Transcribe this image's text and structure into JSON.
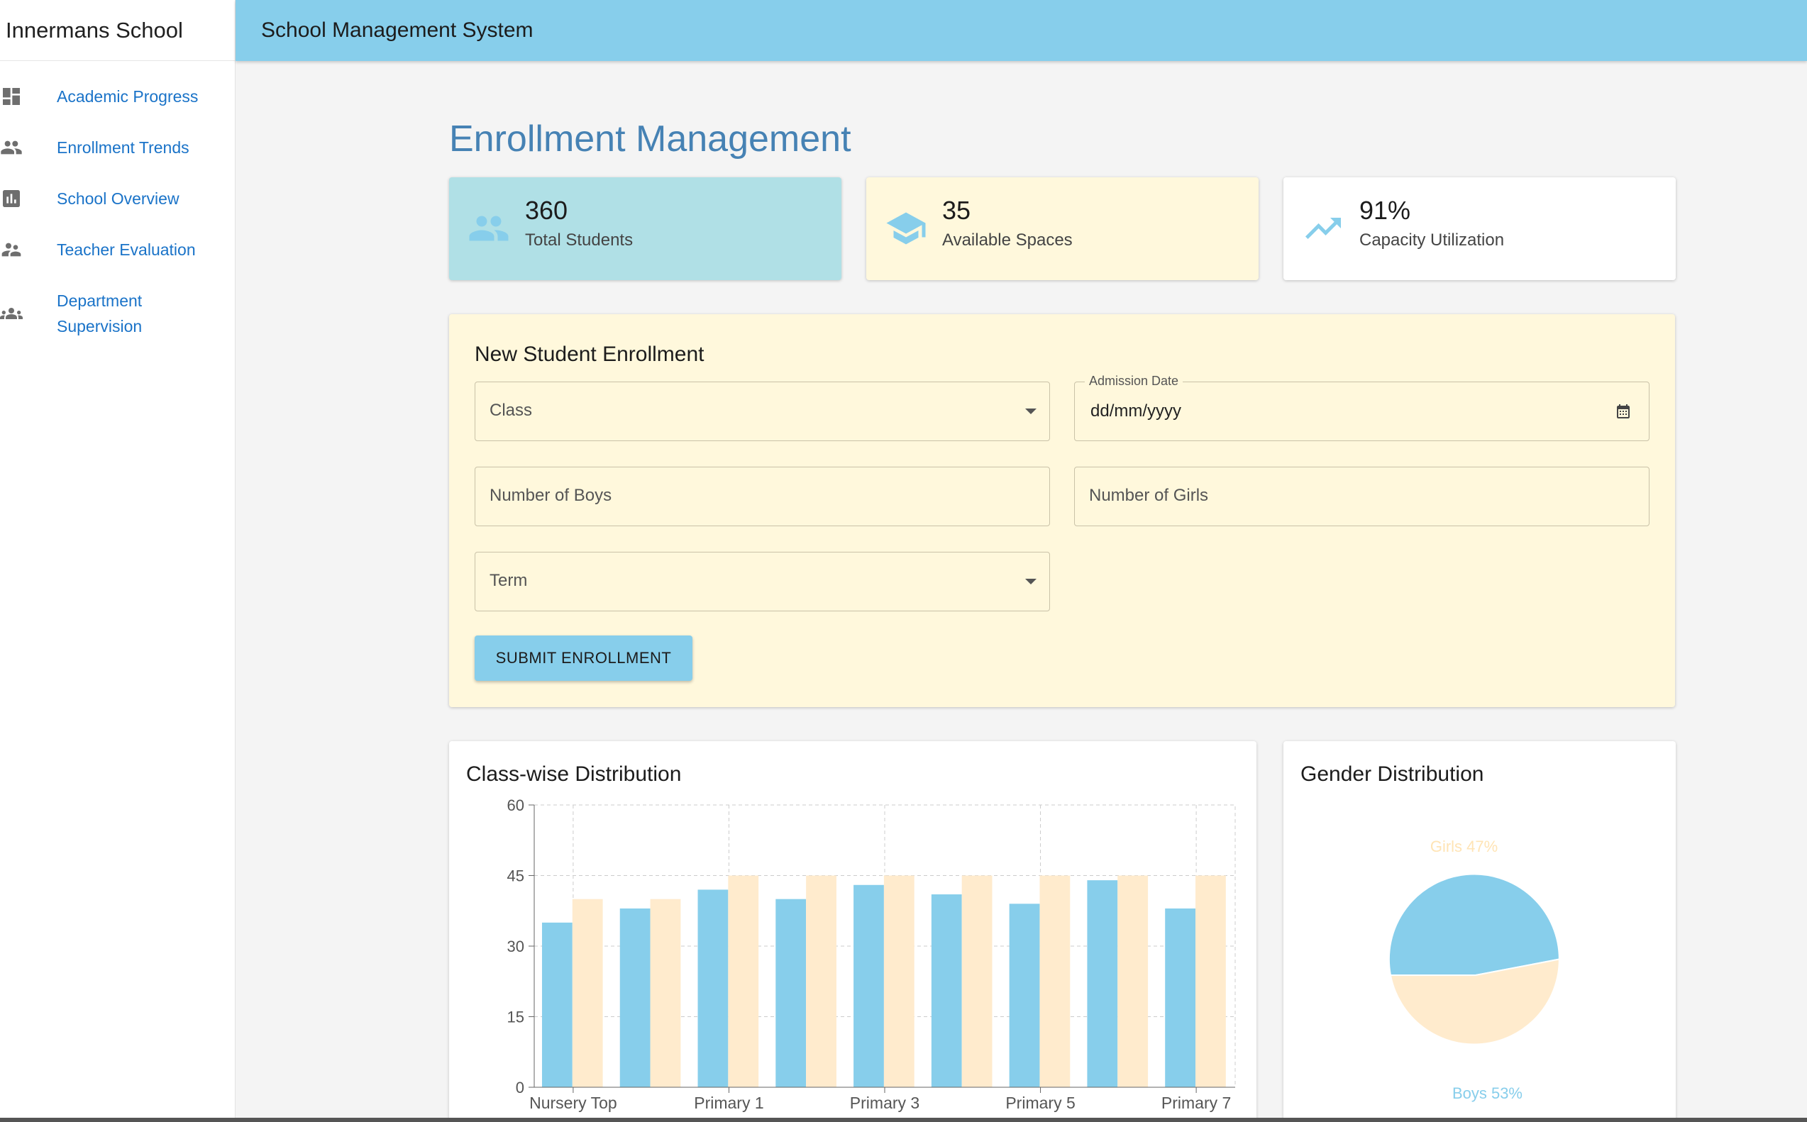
{
  "app": {
    "brand": "Innermans School",
    "title": "School Management System"
  },
  "sidebar": {
    "items": [
      {
        "label": "Academic Progress",
        "icon": "dashboard-icon"
      },
      {
        "label": "Enrollment Trends",
        "icon": "people-icon"
      },
      {
        "label": "School Overview",
        "icon": "bar-chart-icon"
      },
      {
        "label": "Teacher Evaluation",
        "icon": "supervisor-icon"
      },
      {
        "label": "Department Supervision",
        "icon": "groups-icon"
      }
    ]
  },
  "page": {
    "title": "Enrollment Management"
  },
  "stats": [
    {
      "value": "360",
      "label": "Total Students",
      "icon": "people-icon",
      "bg": "#b0e0e6"
    },
    {
      "value": "35",
      "label": "Available Spaces",
      "icon": "graduation-cap-icon",
      "bg": "#fff8dc"
    },
    {
      "value": "91%",
      "label": "Capacity Utilization",
      "icon": "trending-up-icon",
      "bg": "#ffffff"
    }
  ],
  "form": {
    "title": "New Student Enrollment",
    "class_placeholder": "Class",
    "admission_label": "Admission Date",
    "admission_value": "dd/mm/yyyy",
    "boys_placeholder": "Number of Boys",
    "girls_placeholder": "Number of Girls",
    "term_placeholder": "Term",
    "submit_label": "SUBMIT ENROLLMENT"
  },
  "colors": {
    "boys": "#87ceeb",
    "girls": "#ffebcd",
    "accent": "#4682b4"
  },
  "chart_data": [
    {
      "type": "bar",
      "title": "Class-wise Distribution",
      "categories": [
        "Nursery Top",
        "",
        "Primary 1",
        "",
        "Primary 3",
        "",
        "Primary 5",
        "",
        "Primary 7"
      ],
      "series": [
        {
          "values": [
            35,
            38,
            42,
            40,
            43,
            41,
            39,
            44,
            38
          ]
        },
        {
          "values": [
            40,
            40,
            45,
            45,
            45,
            45,
            45,
            45,
            45
          ]
        }
      ],
      "ylim": [
        0,
        60
      ],
      "yticks": [
        0,
        15,
        30,
        45,
        60
      ],
      "grid": true
    },
    {
      "type": "pie",
      "title": "Gender Distribution",
      "slices": [
        {
          "label": "Boys 53%",
          "value": 53
        },
        {
          "label": "Girls 47%",
          "value": 47
        }
      ]
    }
  ]
}
